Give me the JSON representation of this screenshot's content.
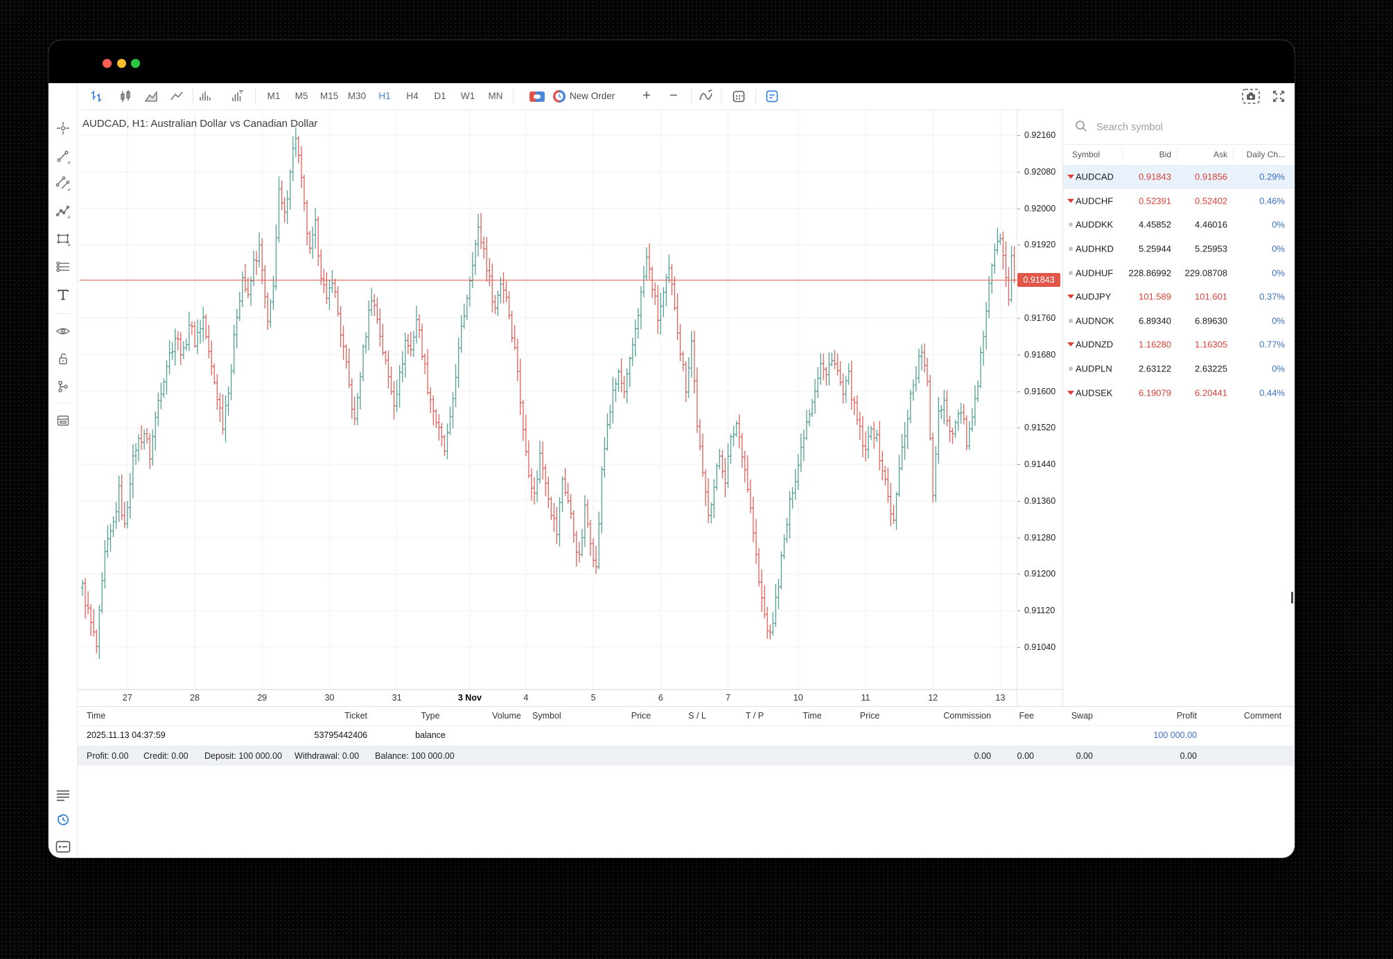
{
  "window": {
    "traffic_lights": {
      "close": "#ff5f57",
      "minimize": "#febc2e",
      "zoom": "#28c840"
    }
  },
  "toolbar": {
    "icons": [
      "menu-icon",
      "bars-chart-icon",
      "candlestick-chart-icon",
      "area-chart-icon",
      "line-chart-icon",
      "volume-icon",
      "tick-volume-icon",
      "trade-panel-icon",
      "new-order-icon",
      "zoom-in-icon",
      "zoom-out-icon",
      "indicators-icon",
      "calendar-icon",
      "objects-icon",
      "screenshot-icon",
      "fullscreen-icon"
    ],
    "timeframes": [
      "M1",
      "M5",
      "M15",
      "M30",
      "H1",
      "H4",
      "D1",
      "W1",
      "MN"
    ],
    "active_timeframe": "H1",
    "new_order_label": "New Order",
    "zoom_in_label": "+",
    "zoom_out_label": "−",
    "accent_blue": "#3b82d9"
  },
  "sidebar_tools": [
    "crosshair-icon",
    "trendline-icon",
    "channel-icon",
    "polyline-icon",
    "shapes-icon",
    "levels-icon",
    "text-icon",
    "eye-icon",
    "unlock-icon",
    "object-tree-icon",
    "window-layout-icon"
  ],
  "bottom_tools": [
    "trade-list-icon",
    "history-icon",
    "journal-icon"
  ],
  "chart": {
    "title": "AUDCAD, H1: Australian Dollar vs Canadian Dollar",
    "current_price": "0.91843",
    "price_line_color": "#e2564a",
    "up_color": "#53a094",
    "down_color": "#e0605a"
  },
  "chart_data": {
    "type": "ohlc-bars",
    "symbol": "AUDCAD",
    "timeframe": "H1",
    "current_price": 0.91843,
    "ylim": [
      0.90947,
      0.92216
    ],
    "y_ticks": [
      "0.92160",
      "0.92080",
      "0.92000",
      "0.91920",
      "0.91760",
      "0.91680",
      "0.91600",
      "0.91520",
      "0.91440",
      "0.91360",
      "0.91280",
      "0.91200",
      "0.91120",
      "0.91040"
    ],
    "y_tick_step": 0.0008,
    "grid": true,
    "bar_count": 333,
    "day_ticks": [
      {
        "label": "27",
        "bar": 16
      },
      {
        "label": "28",
        "bar": 40
      },
      {
        "label": "29",
        "bar": 64
      },
      {
        "label": "30",
        "bar": 88
      },
      {
        "label": "31",
        "bar": 112
      },
      {
        "label": "3 Nov",
        "bar": 138,
        "bold": true
      },
      {
        "label": "4",
        "bar": 158
      },
      {
        "label": "5",
        "bar": 182
      },
      {
        "label": "6",
        "bar": 206
      },
      {
        "label": "7",
        "bar": 230
      },
      {
        "label": "10",
        "bar": 255
      },
      {
        "label": "11",
        "bar": 279
      },
      {
        "label": "12",
        "bar": 303
      },
      {
        "label": "13",
        "bar": 327
      }
    ],
    "anchors": [
      [
        0,
        0.9117
      ],
      [
        3,
        0.9109
      ],
      [
        5,
        0.9104
      ],
      [
        8,
        0.9124
      ],
      [
        11,
        0.9131
      ],
      [
        13,
        0.9138
      ],
      [
        15,
        0.913
      ],
      [
        17,
        0.9141
      ],
      [
        19,
        0.9148
      ],
      [
        22,
        0.9151
      ],
      [
        24,
        0.9146
      ],
      [
        27,
        0.9158
      ],
      [
        30,
        0.9166
      ],
      [
        33,
        0.9172
      ],
      [
        36,
        0.9168
      ],
      [
        38,
        0.9175
      ],
      [
        40,
        0.9171
      ],
      [
        43,
        0.9176
      ],
      [
        45,
        0.9168
      ],
      [
        47,
        0.9162
      ],
      [
        50,
        0.9153
      ],
      [
        53,
        0.9165
      ],
      [
        55,
        0.9177
      ],
      [
        57,
        0.9185
      ],
      [
        59,
        0.918
      ],
      [
        61,
        0.9188
      ],
      [
        63,
        0.9191
      ],
      [
        64,
        0.9186
      ],
      [
        66,
        0.9174
      ],
      [
        68,
        0.9184
      ],
      [
        70,
        0.9203
      ],
      [
        72,
        0.9198
      ],
      [
        74,
        0.9209
      ],
      [
        76,
        0.9216
      ],
      [
        77,
        0.9211
      ],
      [
        79,
        0.92
      ],
      [
        81,
        0.919
      ],
      [
        83,
        0.9196
      ],
      [
        85,
        0.9186
      ],
      [
        87,
        0.9179
      ],
      [
        89,
        0.9185
      ],
      [
        91,
        0.9177
      ],
      [
        93,
        0.9169
      ],
      [
        95,
        0.9161
      ],
      [
        97,
        0.9153
      ],
      [
        99,
        0.9164
      ],
      [
        101,
        0.9173
      ],
      [
        103,
        0.9181
      ],
      [
        105,
        0.9176
      ],
      [
        107,
        0.9169
      ],
      [
        109,
        0.9163
      ],
      [
        111,
        0.9158
      ],
      [
        113,
        0.9163
      ],
      [
        115,
        0.9171
      ],
      [
        117,
        0.9169
      ],
      [
        119,
        0.9176
      ],
      [
        121,
        0.9169
      ],
      [
        123,
        0.9161
      ],
      [
        125,
        0.9156
      ],
      [
        127,
        0.9151
      ],
      [
        129,
        0.9147
      ],
      [
        131,
        0.9153
      ],
      [
        133,
        0.9164
      ],
      [
        135,
        0.9173
      ],
      [
        137,
        0.9181
      ],
      [
        139,
        0.9189
      ],
      [
        141,
        0.9195
      ],
      [
        143,
        0.9191
      ],
      [
        145,
        0.9184
      ],
      [
        147,
        0.9178
      ],
      [
        149,
        0.9184
      ],
      [
        151,
        0.9181
      ],
      [
        153,
        0.9173
      ],
      [
        155,
        0.9165
      ],
      [
        157,
        0.9151
      ],
      [
        159,
        0.9143
      ],
      [
        161,
        0.9137
      ],
      [
        163,
        0.9146
      ],
      [
        165,
        0.9141
      ],
      [
        167,
        0.9134
      ],
      [
        169,
        0.9129
      ],
      [
        171,
        0.9141
      ],
      [
        173,
        0.9136
      ],
      [
        175,
        0.9129
      ],
      [
        177,
        0.9123
      ],
      [
        179,
        0.9134
      ],
      [
        181,
        0.9128
      ],
      [
        183,
        0.9121
      ],
      [
        185,
        0.9142
      ],
      [
        187,
        0.9153
      ],
      [
        189,
        0.9159
      ],
      [
        191,
        0.9164
      ],
      [
        193,
        0.9159
      ],
      [
        195,
        0.9166
      ],
      [
        197,
        0.9174
      ],
      [
        199,
        0.9181
      ],
      [
        201,
        0.9189
      ],
      [
        203,
        0.9183
      ],
      [
        205,
        0.9176
      ],
      [
        207,
        0.9181
      ],
      [
        209,
        0.9186
      ],
      [
        211,
        0.9179
      ],
      [
        213,
        0.9169
      ],
      [
        215,
        0.9161
      ],
      [
        217,
        0.9171
      ],
      [
        219,
        0.9153
      ],
      [
        221,
        0.9141
      ],
      [
        223,
        0.9134
      ],
      [
        225,
        0.9139
      ],
      [
        227,
        0.9146
      ],
      [
        229,
        0.9141
      ],
      [
        231,
        0.9149
      ],
      [
        233,
        0.9153
      ],
      [
        235,
        0.9147
      ],
      [
        237,
        0.9139
      ],
      [
        239,
        0.9129
      ],
      [
        241,
        0.9118
      ],
      [
        243,
        0.9111
      ],
      [
        245,
        0.9106
      ],
      [
        247,
        0.9114
      ],
      [
        249,
        0.9123
      ],
      [
        251,
        0.9131
      ],
      [
        253,
        0.9139
      ],
      [
        255,
        0.9144
      ],
      [
        257,
        0.9151
      ],
      [
        259,
        0.9156
      ],
      [
        261,
        0.9161
      ],
      [
        263,
        0.9166
      ],
      [
        265,
        0.9163
      ],
      [
        267,
        0.9168
      ],
      [
        269,
        0.9164
      ],
      [
        271,
        0.9159
      ],
      [
        273,
        0.9163
      ],
      [
        275,
        0.9156
      ],
      [
        277,
        0.9151
      ],
      [
        279,
        0.9146
      ],
      [
        281,
        0.9153
      ],
      [
        283,
        0.9149
      ],
      [
        285,
        0.9143
      ],
      [
        287,
        0.9137
      ],
      [
        289,
        0.9131
      ],
      [
        291,
        0.9143
      ],
      [
        293,
        0.9151
      ],
      [
        295,
        0.9159
      ],
      [
        297,
        0.9164
      ],
      [
        299,
        0.9169
      ],
      [
        301,
        0.9161
      ],
      [
        303,
        0.9138
      ],
      [
        305,
        0.9156
      ],
      [
        307,
        0.9158
      ],
      [
        309,
        0.9151
      ],
      [
        311,
        0.9153
      ],
      [
        313,
        0.9156
      ],
      [
        315,
        0.9149
      ],
      [
        317,
        0.9153
      ],
      [
        319,
        0.9161
      ],
      [
        321,
        0.9173
      ],
      [
        323,
        0.9185
      ],
      [
        325,
        0.9191
      ],
      [
        327,
        0.9193
      ],
      [
        329,
        0.9186
      ],
      [
        330,
        0.9179
      ],
      [
        331,
        0.9189
      ],
      [
        332,
        0.91843
      ]
    ]
  },
  "market_watch": {
    "search_placeholder": "Search symbol",
    "columns": [
      "Symbol",
      "Bid",
      "Ask",
      "Daily Ch..."
    ],
    "rows": [
      {
        "symbol": "AUDCAD",
        "bid": "0.91843",
        "ask": "0.91856",
        "change": "0.29%",
        "dir": "down",
        "selected": true
      },
      {
        "symbol": "AUDCHF",
        "bid": "0.52391",
        "ask": "0.52402",
        "change": "0.46%",
        "dir": "down",
        "selected": false
      },
      {
        "symbol": "AUDDKK",
        "bid": "4.45852",
        "ask": "4.46016",
        "change": "0%",
        "dir": "flat",
        "selected": false
      },
      {
        "symbol": "AUDHKD",
        "bid": "5.25944",
        "ask": "5.25953",
        "change": "0%",
        "dir": "flat",
        "selected": false
      },
      {
        "symbol": "AUDHUF",
        "bid": "228.86992",
        "ask": "229.08708",
        "change": "0%",
        "dir": "flat",
        "selected": false
      },
      {
        "symbol": "AUDJPY",
        "bid": "101.589",
        "ask": "101.601",
        "change": "0.37%",
        "dir": "down",
        "selected": false
      },
      {
        "symbol": "AUDNOK",
        "bid": "6.89340",
        "ask": "6.89630",
        "change": "0%",
        "dir": "flat",
        "selected": false
      },
      {
        "symbol": "AUDNZD",
        "bid": "1.16280",
        "ask": "1.16305",
        "change": "0.77%",
        "dir": "down",
        "selected": false
      },
      {
        "symbol": "AUDPLN",
        "bid": "2.63122",
        "ask": "2.63225",
        "change": "0%",
        "dir": "flat",
        "selected": false
      },
      {
        "symbol": "AUDSEK",
        "bid": "6.19079",
        "ask": "6.20441",
        "change": "0.44%",
        "dir": "down",
        "selected": false
      }
    ],
    "value_down_color": "#d94136",
    "change_color": "#3a6fc0"
  },
  "toolbox": {
    "columns": [
      "Time",
      "Ticket",
      "Type",
      "Volume",
      "Symbol",
      "Price",
      "S / L",
      "T / P",
      "Time",
      "Price",
      "Commission",
      "Fee",
      "Swap",
      "Profit",
      "Comment"
    ],
    "balance_row": {
      "time": "2025.11.13 04:37:59",
      "ticket": "53795442406",
      "type": "balance",
      "profit": "100 000.00"
    },
    "summary": {
      "profit": "Profit: 0.00",
      "credit": "Credit: 0.00",
      "deposit": "Deposit: 100 000.00",
      "withdrawal": "Withdrawal: 0.00",
      "balance": "Balance: 100 000.00",
      "commission": "0.00",
      "fee": "0.00",
      "swap": "0.00",
      "profit_total": "0.00"
    }
  }
}
